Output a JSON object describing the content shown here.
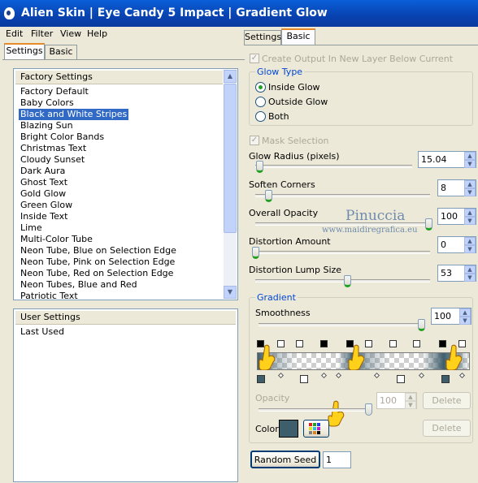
{
  "window": {
    "title": "Alien Skin | Eye Candy 5 Impact | Gradient Glow"
  },
  "menu": [
    "Edit",
    "Filter",
    "View",
    "Help"
  ],
  "left_tabs": [
    "Settings",
    "Basic"
  ],
  "right_tabs": [
    "Settings",
    "Basic"
  ],
  "factory_settings": {
    "header": "Factory Settings",
    "items": [
      "Factory Default",
      "Baby Colors",
      "Black and White Stripes",
      "Blazing Sun",
      "Bright Color Bands",
      "Christmas Text",
      "Cloudy Sunset",
      "Dark Aura",
      "Ghost Text",
      "Gold Glow",
      "Green Glow",
      "Inside Text",
      "Lime",
      "Multi-Color Tube",
      "Neon Tube, Blue on Selection Edge",
      "Neon Tube, Pink on Selection Edge",
      "Neon Tube, Red on Selection Edge",
      "Neon Tubes, Blue and Red",
      "Patriotic Text"
    ],
    "selected": "Black and White Stripes"
  },
  "user_settings": {
    "header": "User Settings",
    "items": [
      "Last Used"
    ]
  },
  "basic": {
    "create_output_label": "Create Output In New Layer Below Current",
    "create_output_checked": true,
    "glow_type": {
      "label": "Glow Type",
      "options": [
        "Inside Glow",
        "Outside Glow",
        "Both"
      ],
      "selected": "Inside Glow"
    },
    "mask_selection_label": "Mask Selection",
    "mask_selection_checked": true,
    "sliders": [
      {
        "label": "Glow Radius (pixels)",
        "value": "15.04",
        "fraction": 0.03
      },
      {
        "label": "Soften Corners",
        "value": "8",
        "fraction": 0.08
      },
      {
        "label": "Overall Opacity",
        "value": "100",
        "fraction": 1.0
      },
      {
        "label": "Distortion Amount",
        "value": "0",
        "fraction": 0.0
      },
      {
        "label": "Distortion Lump Size",
        "value": "53",
        "fraction": 0.53
      }
    ],
    "gradient": {
      "label": "Gradient",
      "smoothness_label": "Smoothness",
      "smoothness_value": "100",
      "smoothness_fraction": 1.0,
      "opacity_label": "Opacity",
      "opacity_value": "100",
      "opacity_fraction": 1.0,
      "delete_label": "Delete",
      "color_label": "Color",
      "color_swatch": "#3f5e6b",
      "color_delete_label": "Delete"
    },
    "random_seed_label": "Random Seed",
    "random_seed_value": "1"
  },
  "watermark": {
    "name": "Pinuccia",
    "url": "www.maidiregrafica.eu"
  },
  "colors": {
    "title_bar": "#0842b0",
    "selection": "#316ac5",
    "group_label": "#0046d5",
    "accent_tab": "#e68b2c",
    "gradient_dark": "#3f5e6b"
  }
}
